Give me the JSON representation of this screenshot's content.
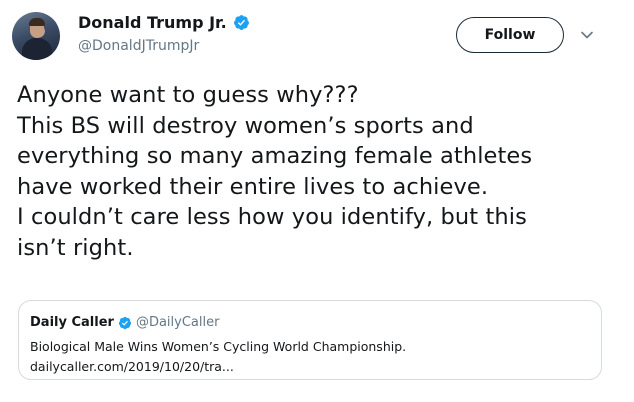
{
  "author": {
    "display_name": "Donald Trump Jr.",
    "handle": "@DonaldJTrumpJr",
    "verified": true
  },
  "actions": {
    "follow_label": "Follow",
    "menu_icon": "chevron-down-icon"
  },
  "tweet": {
    "lines": [
      "Anyone want to guess why???",
      "This BS will destroy women’s sports and",
      "everything so many amazing female athletes",
      "have worked their entire lives to achieve.",
      "I couldn’t care less how you identify, but this",
      "isn’t right."
    ]
  },
  "quoted_tweet": {
    "display_name": "Daily Caller",
    "handle": "@DailyCaller",
    "verified": true,
    "text": "Biological Male Wins Women’s Cycling World Championship.",
    "link": "dailycaller.com/2019/10/20/tra..."
  },
  "colors": {
    "verified_blue": "#1da1f2",
    "text_primary": "#14171a",
    "text_secondary": "#657786",
    "border": "#d4dbe1"
  }
}
